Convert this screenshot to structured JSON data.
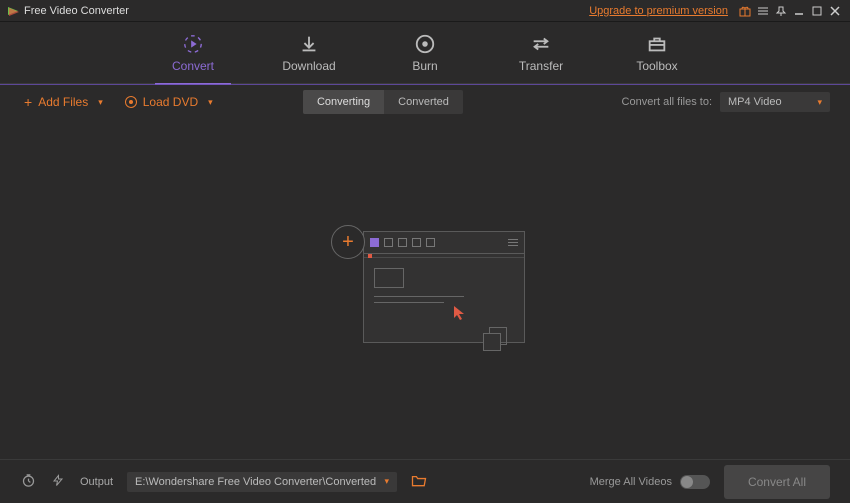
{
  "titlebar": {
    "app_title": "Free Video Converter",
    "upgrade_label": "Upgrade to premium version"
  },
  "tabs": {
    "convert": "Convert",
    "download": "Download",
    "burn": "Burn",
    "transfer": "Transfer",
    "toolbox": "Toolbox"
  },
  "toolbar": {
    "add_files": "Add Files",
    "load_dvd": "Load DVD",
    "converting": "Converting",
    "converted": "Converted",
    "convert_all_label": "Convert all files to:",
    "target_format": "MP4 Video"
  },
  "footer": {
    "output_label": "Output",
    "output_path": "E:\\Wondershare Free Video Converter\\Converted",
    "merge_label": "Merge All Videos",
    "convert_all_btn": "Convert All"
  }
}
